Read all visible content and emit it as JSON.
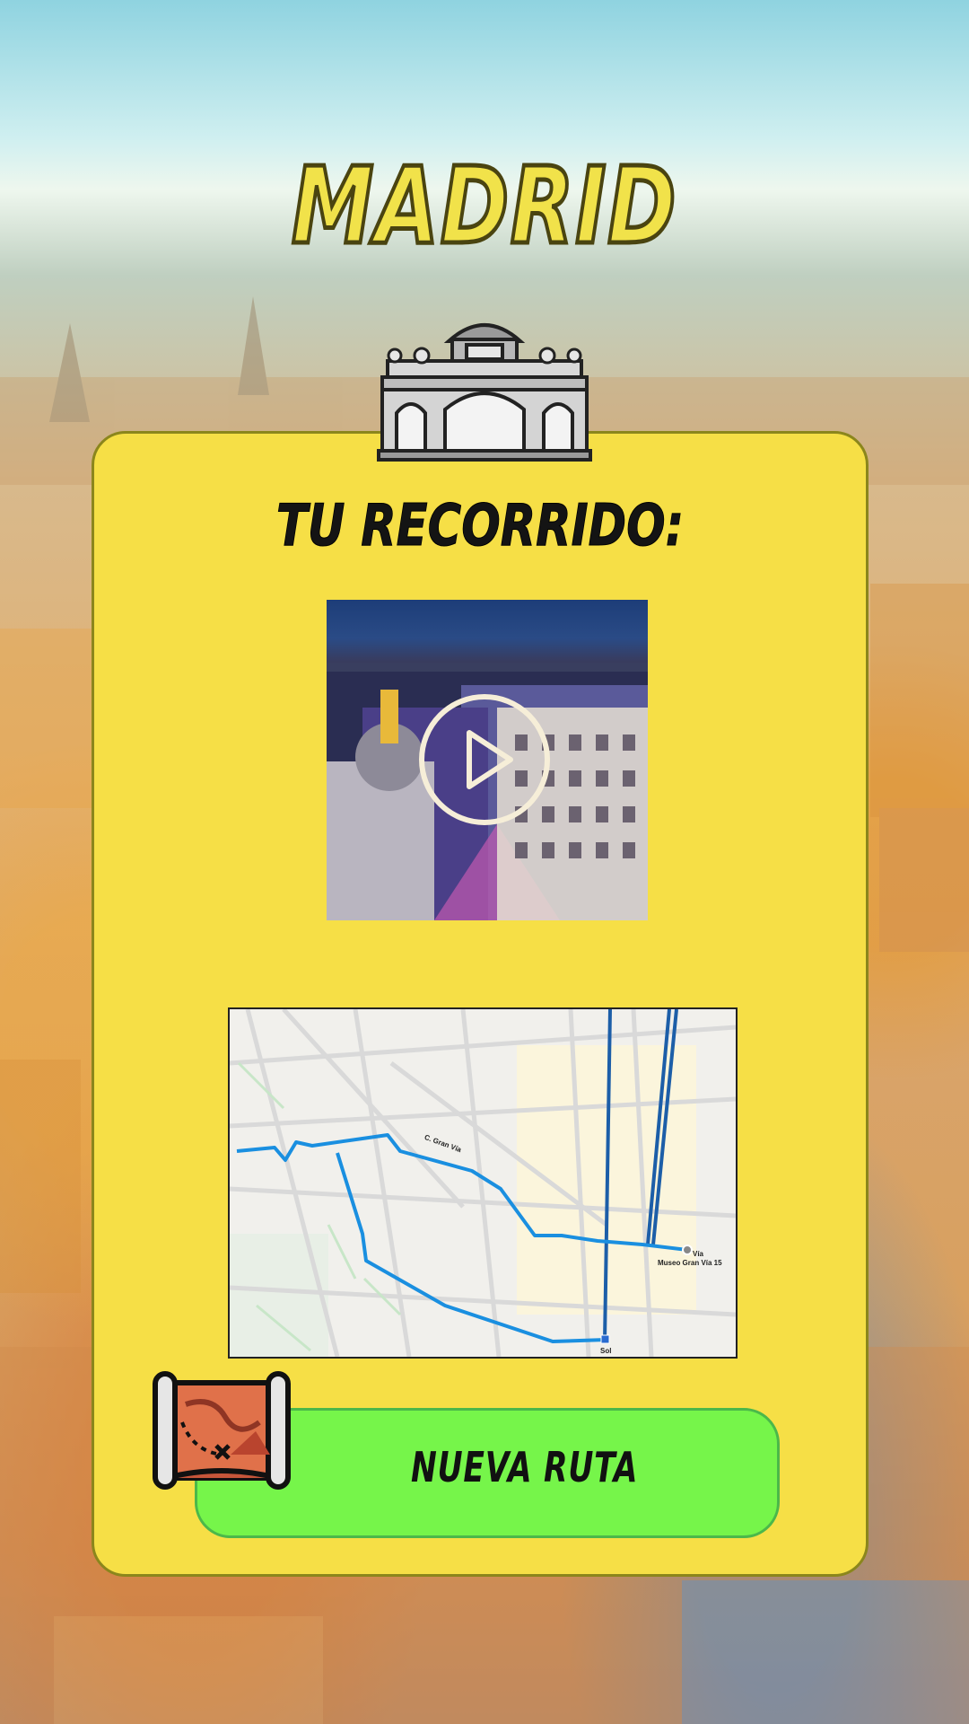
{
  "app": {
    "city_title": "MADRID",
    "tour_heading": "TU RECORRIDO:"
  },
  "video": {
    "play_icon": "play-circle-icon"
  },
  "map": {
    "labels": {
      "museum": "Museo Gran Vía 15",
      "station": "Sol",
      "via": "Vía",
      "gran_via": "C. Gran Vía"
    }
  },
  "actions": {
    "new_route_label": "NUEVA RUTA",
    "new_route_icon": "treasure-map-icon"
  },
  "colors": {
    "card": "#f6df46",
    "button": "#76f54a",
    "title": "#f1e24a",
    "route": "#1a8fe0"
  }
}
